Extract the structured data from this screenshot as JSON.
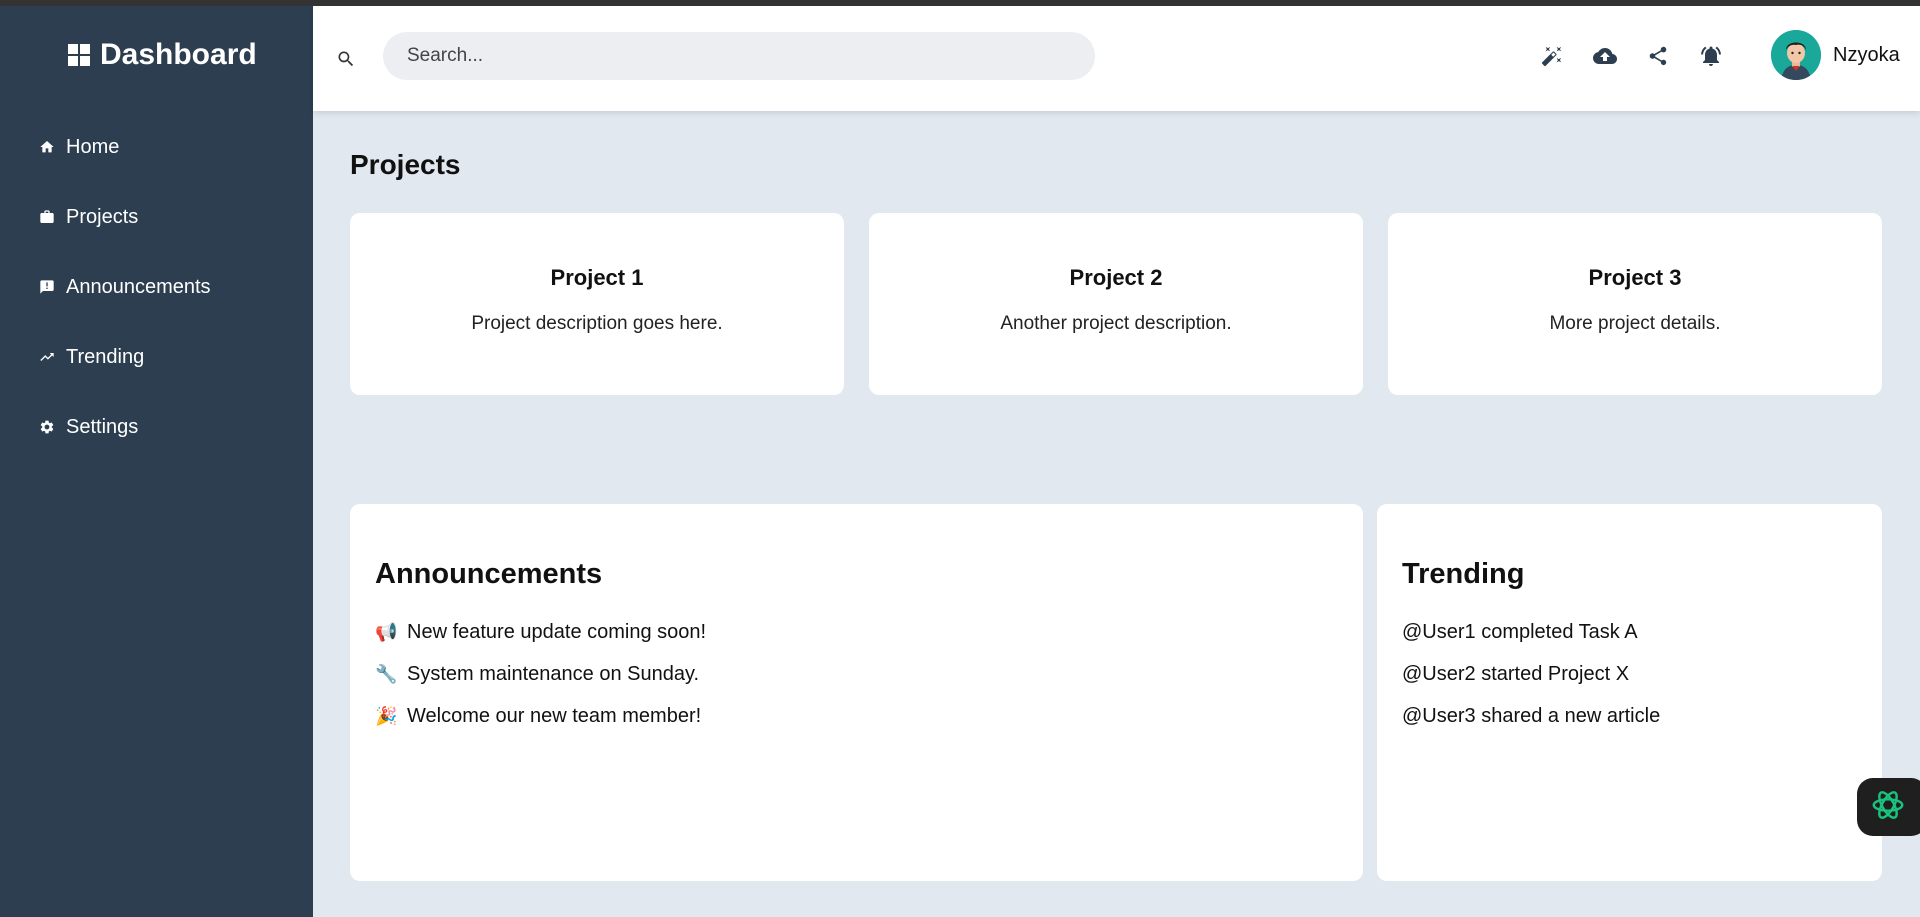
{
  "brand": {
    "title": "Dashboard"
  },
  "sidebar": {
    "items": [
      {
        "label": "Home",
        "icon": "home-icon"
      },
      {
        "label": "Projects",
        "icon": "briefcase-icon"
      },
      {
        "label": "Announcements",
        "icon": "announcement-icon"
      },
      {
        "label": "Trending",
        "icon": "trending-up-icon"
      },
      {
        "label": "Settings",
        "icon": "gear-icon"
      }
    ]
  },
  "header": {
    "search": {
      "placeholder": "Search..."
    },
    "icons": [
      "magic-wand-icon",
      "cloud-upload-icon",
      "share-icon",
      "bell-icon"
    ],
    "user": {
      "name": "Nzyoka"
    }
  },
  "main": {
    "title": "Projects",
    "projects": [
      {
        "title": "Project 1",
        "description": "Project description goes here."
      },
      {
        "title": "Project 2",
        "description": "Another project description."
      },
      {
        "title": "Project 3",
        "description": "More project details."
      }
    ],
    "announcements": {
      "title": "Announcements",
      "items": [
        {
          "emoji": "📢",
          "text": "New feature update coming soon!"
        },
        {
          "emoji": "🔧",
          "text": "System maintenance on Sunday."
        },
        {
          "emoji": "🎉",
          "text": "Welcome our new team member!"
        }
      ]
    },
    "trending": {
      "title": "Trending",
      "items": [
        "@User1 completed Task A",
        "@User2 started Project X",
        "@User3 shared a new article"
      ]
    }
  },
  "colors": {
    "sidebar": "#2c3e50",
    "background": "#e2e8f0",
    "avatar": "#1aa89a"
  }
}
